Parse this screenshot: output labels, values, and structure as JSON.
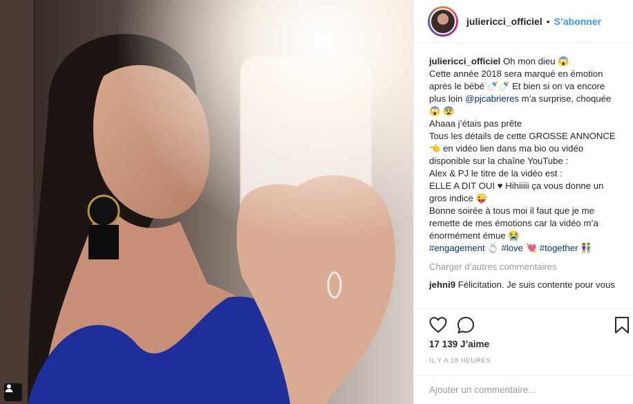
{
  "post": {
    "username": "juliericci_officiel",
    "separator": "•",
    "follow_label": "S’abonner"
  },
  "caption": {
    "username": "juliericci_officiel",
    "line1": "Oh mon dieu 😱",
    "line2a": "Cette année 2018 sera marqué en émotion après le bébé 🍼🍼 Et bien si on va encore plus loin ",
    "mention": "@pjcabrieres",
    "line2b": " m’a surprise, choquée 😱 😨",
    "line3": "Ahaaa j’étais pas prête",
    "line4": "Tous les détails de cette GROSSE ANNONCE 👈 en vidéo lien dans ma bio ou vidéo disponible sur la chaîne YouTube :",
    "line5": "Alex & PJ le titre de la vidéo est :",
    "line6": "ELLE A DIT OUI ♥ Hihiiiii ça vous donne un gros indice 😜",
    "line7": "Bonne soirée à tous moi il faut que je me remette de mes émotions car la vidéo m’a énormément émue 😭",
    "tag1": "#engagement",
    "tag1_emoji": "💍",
    "tag2": "#love",
    "tag2_emoji": "💘",
    "tag3": "#together",
    "tag3_emoji": "👫"
  },
  "load_more_label": "Charger d’autres commentaires",
  "reply": {
    "username": "jehni9",
    "text": "Félicitation. Je suis contente pour vous"
  },
  "actions": {
    "like_icon": "heart-icon",
    "comment_icon": "comment-icon",
    "save_icon": "bookmark-icon"
  },
  "likes_text": "17 139 J’aime",
  "timestamp": "IL Y A 18 HEURES",
  "add_comment_placeholder": "Ajouter un commentaire...",
  "colors": {
    "link": "#3897f0",
    "mention": "#003569",
    "muted": "#999999"
  }
}
